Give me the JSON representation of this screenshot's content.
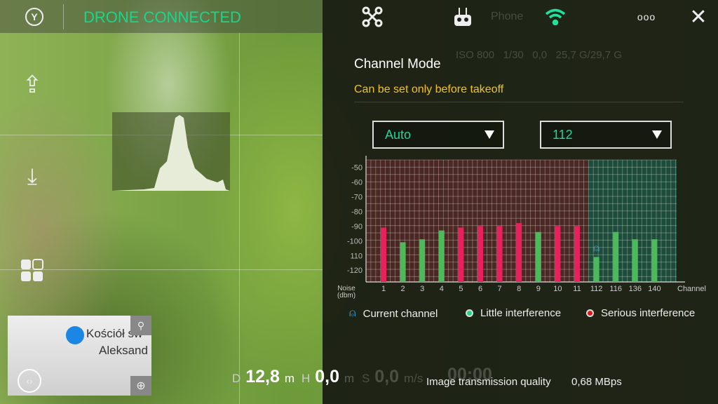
{
  "status": {
    "text": "DRONE CONNECTED",
    "color": "#19d68a"
  },
  "top_icons": [
    "drone-settings-icon",
    "remote-controller-icon",
    "wifi-icon",
    "more-icon",
    "close-icon"
  ],
  "background_text": {
    "phone": "Phone",
    "iso_label": "ISO",
    "iso": "800",
    "shutter": "1/30",
    "ev": "0,0",
    "storage": "25,7 G/29,7 G"
  },
  "panel": {
    "title": "Channel Mode",
    "subtitle": "Can be set only before takeoff",
    "mode_select": "Auto",
    "channel_select": "112"
  },
  "chart_data": {
    "type": "bar",
    "xlabel": "Channel",
    "ylabel": "Noise (dbm)",
    "ylabel_lines": [
      "Noise",
      "(dbm)"
    ],
    "categories": [
      "1",
      "2",
      "3",
      "4",
      "5",
      "6",
      "7",
      "8",
      "9",
      "10",
      "11",
      "112",
      "116",
      "136",
      "140"
    ],
    "values": [
      -91,
      -101,
      -99,
      -93,
      -91,
      -90,
      -90,
      -88,
      -94,
      -90,
      -90,
      -111,
      -94,
      -99,
      -99
    ],
    "interference": [
      "serious",
      "little",
      "little",
      "little",
      "serious",
      "serious",
      "serious",
      "serious",
      "little",
      "serious",
      "serious",
      "little",
      "little",
      "little",
      "little"
    ],
    "current_channel": "112",
    "yticks": [
      "-50",
      "-60",
      "-70",
      "-80",
      "-90",
      "-100",
      "110",
      "-120"
    ],
    "ytick_values": [
      -50,
      -60,
      -70,
      -80,
      -90,
      -100,
      -110,
      -120
    ],
    "ylim": [
      -128,
      -45
    ],
    "grid": true,
    "colors": {
      "serious": "#e8215e",
      "little": "#4cba5a",
      "band_24": "#5a2a28",
      "band_58": "#1f5a48",
      "current": "#2aa6e8"
    }
  },
  "legend": {
    "current": "Current channel",
    "little": "Little interference",
    "serious": "Serious interference"
  },
  "telemetry": {
    "d_label": "D",
    "d_value": "12,8",
    "d_unit": "m",
    "h_label": "H",
    "h_value": "0,0",
    "h_unit": "m",
    "s_label": "S",
    "s_value": "0,0",
    "s_unit": "m/s",
    "time": "00:00"
  },
  "transmission": {
    "label": "Image transmission quality",
    "value": "0,68 MBps"
  },
  "map": {
    "place_line1": "Kościół św",
    "place_line2": "Aleksand"
  }
}
